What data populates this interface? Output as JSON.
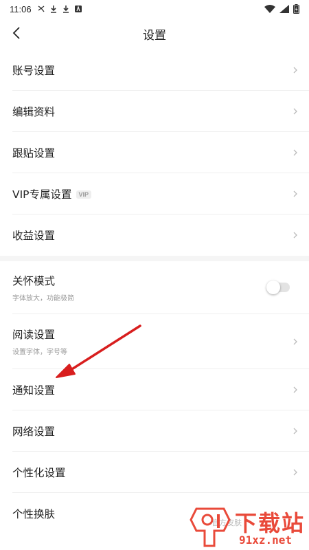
{
  "status_bar": {
    "time": "11:06",
    "left_icons": [
      "notification-icon",
      "download-icon",
      "download-icon",
      "app-icon"
    ],
    "right_icons": [
      "wifi-icon",
      "signal-icon",
      "battery-charging-icon"
    ]
  },
  "nav": {
    "title": "设置",
    "back_icon": "chevron-left-icon"
  },
  "group1": [
    {
      "label": "账号设置"
    },
    {
      "label": "编辑资料"
    },
    {
      "label": "跟贴设置"
    },
    {
      "label": "VIP专属设置",
      "badge": "VIP"
    },
    {
      "label": "收益设置"
    }
  ],
  "group2": {
    "care_mode": {
      "label": "关怀模式",
      "subtitle": "字体放大，功能极简",
      "toggle_on": false
    },
    "reading": {
      "label": "阅读设置",
      "subtitle": "设置字体，字号等"
    },
    "notification": {
      "label": "通知设置"
    },
    "network": {
      "label": "网络设置"
    },
    "personalization": {
      "label": "个性化设置"
    },
    "skin": {
      "label": "个性换肤",
      "peek": "官方皮肤"
    }
  },
  "annotation": {
    "color": "#d81e1e"
  },
  "watermark": {
    "text": "下载站",
    "url": "91xz.net",
    "color": "#e94a3a"
  }
}
